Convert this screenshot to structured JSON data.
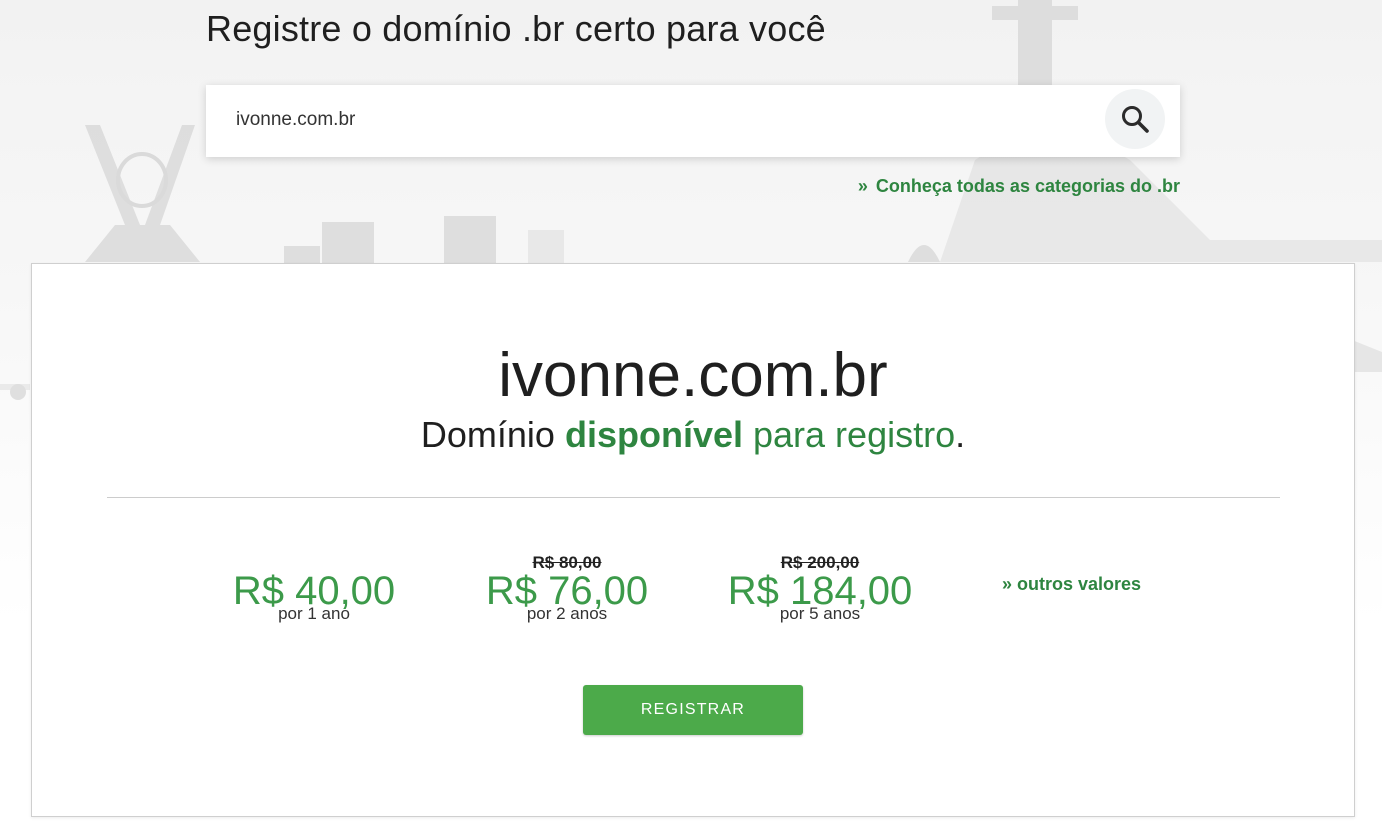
{
  "header": {
    "headline": "Registre o domínio .br certo para você"
  },
  "search": {
    "value": "ivonne.com.br",
    "button_icon": "search-icon"
  },
  "categories_link": {
    "marker": "»",
    "label": "Conheça todas as categorias do .br"
  },
  "result": {
    "domain": "ivonne.com.br",
    "status_prefix": "Domínio",
    "status_highlight": "disponível",
    "status_suffix": "para registro",
    "status_end": ".",
    "prices": [
      {
        "old_price": "",
        "price": "R$ 40,00",
        "period": "por 1 ano"
      },
      {
        "old_price": "R$ 80,00",
        "price": "R$ 76,00",
        "period": "por 2 anos"
      },
      {
        "old_price": "R$ 200,00",
        "price": "R$ 184,00",
        "period": "por 5 anos"
      }
    ],
    "other_prices_label": "» outros valores",
    "register_label": "REGISTRAR"
  },
  "colors": {
    "accent_green": "#2e8540",
    "price_green": "#3c9a4a",
    "button_green": "#4caa4a"
  }
}
